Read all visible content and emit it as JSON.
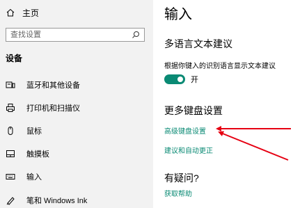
{
  "sidebar": {
    "home": "主页",
    "search_placeholder": "查找设置",
    "section_title": "设备",
    "items": [
      {
        "label": "蓝牙和其他设备",
        "icon": "bluetooth-devices-icon"
      },
      {
        "label": "打印机和扫描仪",
        "icon": "printer-icon"
      },
      {
        "label": "鼠标",
        "icon": "mouse-icon"
      },
      {
        "label": "触摸板",
        "icon": "touchpad-icon"
      },
      {
        "label": "输入",
        "icon": "keyboard-icon"
      },
      {
        "label": "笔和 Windows Ink",
        "icon": "pen-icon"
      }
    ]
  },
  "main": {
    "title": "输入",
    "multilang_heading": "多语言文本建议",
    "multilang_desc": "根据你键入的识别语言显示文本建议",
    "toggle_label": "开",
    "toggle_on": true,
    "more_heading": "更多键盘设置",
    "advanced_link": "高级键盘设置",
    "suggest_link": "建议和自动更正",
    "question_heading": "有疑问?",
    "help_link": "获取帮助"
  },
  "colors": {
    "accent": "#0a8a74",
    "annotation": "#e60012",
    "sidebar_bg": "#f2f2f2"
  }
}
